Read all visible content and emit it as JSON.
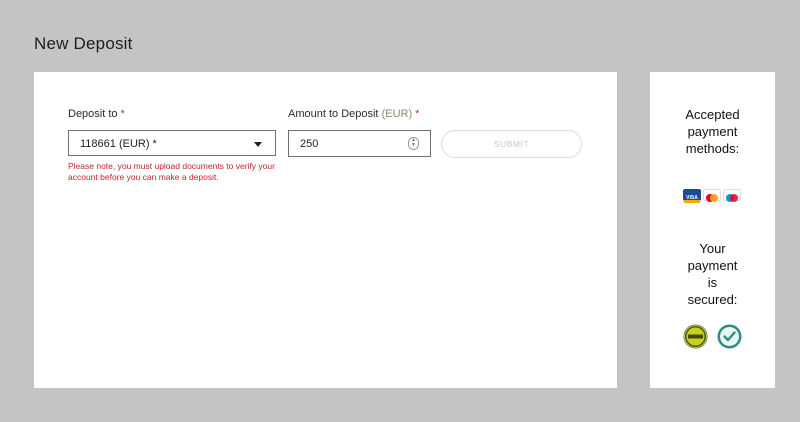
{
  "page": {
    "title": "New Deposit"
  },
  "form": {
    "deposit_to": {
      "label": "Deposit to",
      "required_mark": "*",
      "selected_value": "118661 (EUR) *"
    },
    "warning": "Please note, you must upload documents to verify your account before you can make a deposit.",
    "amount": {
      "label": "Amount to Deposit",
      "currency": "(EUR)",
      "required_mark": "*",
      "value": "250"
    },
    "submit_label": "SUBMIT"
  },
  "sidebar": {
    "accepted_heading_lines": [
      "Accepted",
      "payment",
      "methods:"
    ],
    "payment_icons": [
      "visa-icon",
      "mastercard-icon",
      "maestro-icon"
    ],
    "secured_heading_lines": [
      "Your",
      "payment",
      "is",
      "secured:"
    ],
    "security_badges": [
      "security-seal-icon",
      "verified-badge-icon"
    ]
  },
  "colors": {
    "background": "#c4c4c5",
    "required": "#c0392b",
    "warning": "#c0262d",
    "submit_text_disabled": "#c8c8c8"
  }
}
